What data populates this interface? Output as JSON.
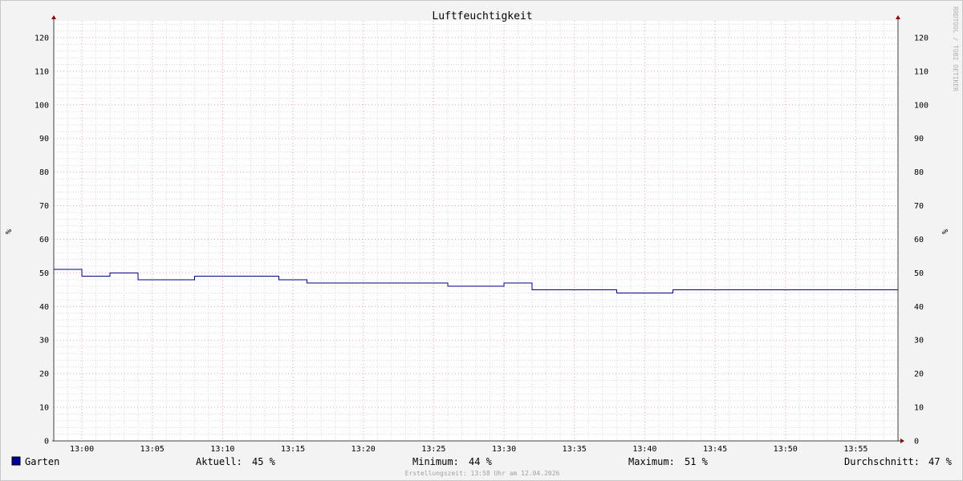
{
  "colors": {
    "series": "#000080",
    "legend_swatch": "#00009c",
    "grid_minor": "#d8d8d8",
    "grid_major": "#f0a0a0",
    "axis": "#404040",
    "arrow": "#8b0000",
    "plot_bg": "#ffffff",
    "canvas_bg": "#f3f3f3"
  },
  "watermark": "RRDTOOL / TOBI OETIKER",
  "timestamp_label": "Erstellungszeit: 13:58 Uhr am 12.04.2026",
  "legend": {
    "series_name": "Garten",
    "current_label": "Aktuell:",
    "current_value": "45 %",
    "min_label": "Minimum:",
    "min_value": "44 %",
    "max_label": "Maximum:",
    "max_value": "51 %",
    "avg_label": "Durchschnitt:",
    "avg_value": "47 %"
  },
  "chart_data": {
    "type": "line",
    "title": "Luftfeuchtigkeit",
    "ylabel_left": "%",
    "ylabel_right": "%",
    "ylim": [
      0,
      125
    ],
    "xlim_minutes": [
      "12:58",
      "13:58"
    ],
    "y_ticks": [
      0,
      10,
      20,
      30,
      40,
      50,
      60,
      70,
      80,
      90,
      100,
      110,
      120
    ],
    "x_ticks": [
      "13:00",
      "13:05",
      "13:10",
      "13:15",
      "13:20",
      "13:25",
      "13:30",
      "13:35",
      "13:40",
      "13:45",
      "13:50",
      "13:55"
    ],
    "grid": true,
    "legend_position": "bottom",
    "series": [
      {
        "name": "Garten",
        "step": true,
        "points": [
          {
            "time": "12:58",
            "value": 51
          },
          {
            "time": "13:00",
            "value": 49
          },
          {
            "time": "13:02",
            "value": 50
          },
          {
            "time": "13:04",
            "value": 48
          },
          {
            "time": "13:08",
            "value": 49
          },
          {
            "time": "13:14",
            "value": 48
          },
          {
            "time": "13:16",
            "value": 47
          },
          {
            "time": "13:26",
            "value": 46
          },
          {
            "time": "13:30",
            "value": 47
          },
          {
            "time": "13:32",
            "value": 45
          },
          {
            "time": "13:38",
            "value": 44
          },
          {
            "time": "13:42",
            "value": 45
          },
          {
            "time": "13:58",
            "value": 45
          }
        ]
      }
    ]
  }
}
